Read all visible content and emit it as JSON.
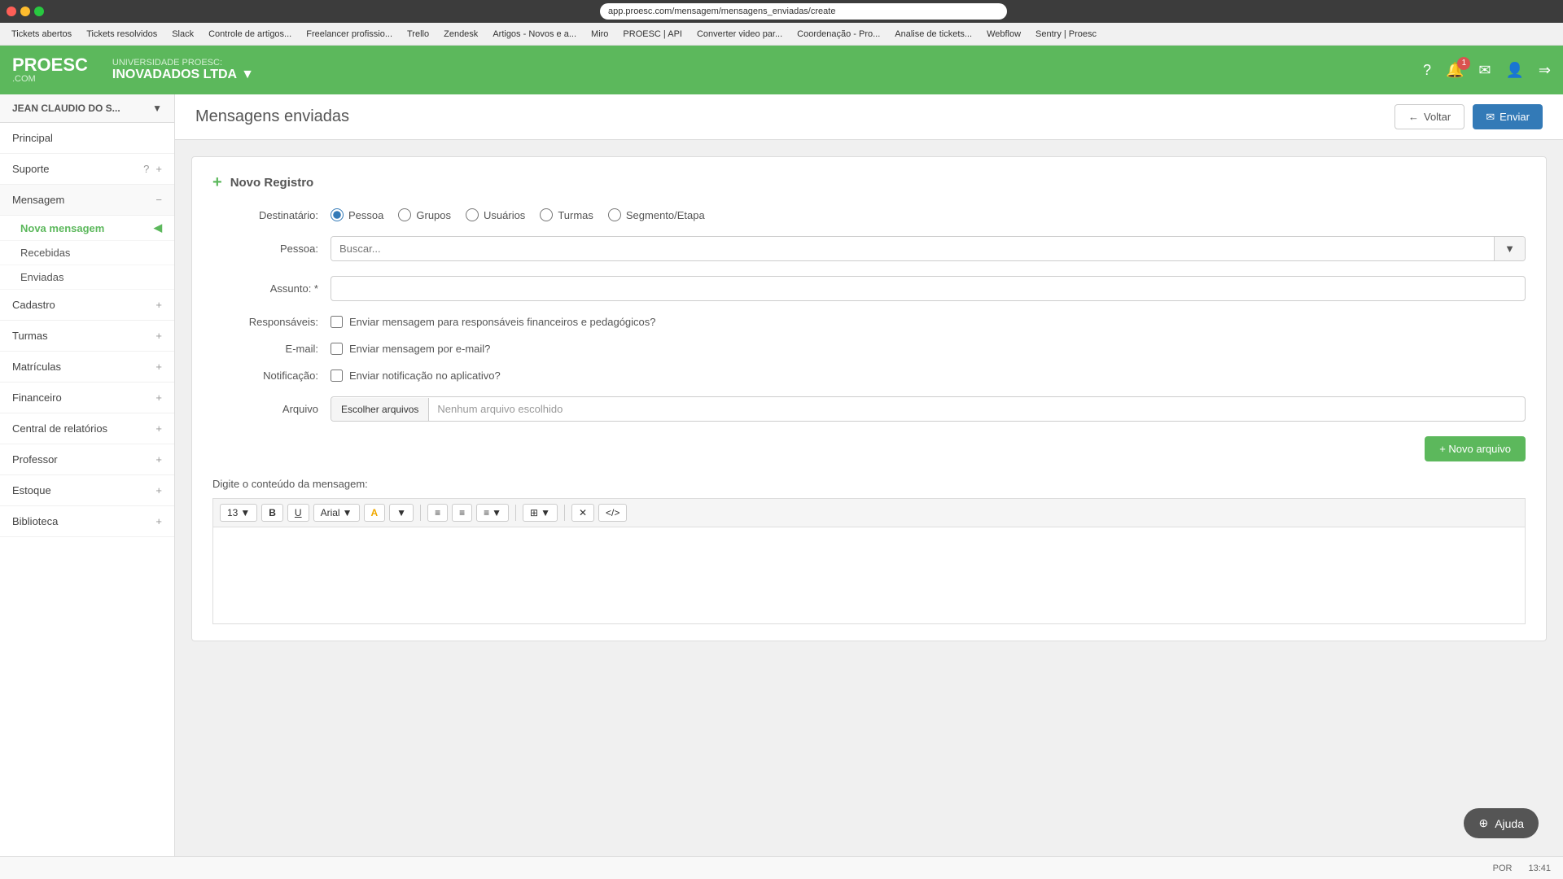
{
  "browser": {
    "url": "app.proesc.com/mensagem/mensagens_enviadas/create",
    "bookmarks": [
      {
        "label": "Tickets abertos"
      },
      {
        "label": "Tickets resolvidos"
      },
      {
        "label": "Slack"
      },
      {
        "label": "Controle de artigos..."
      },
      {
        "label": "Freelancer profissio..."
      },
      {
        "label": "Trello"
      },
      {
        "label": "Zendesk"
      },
      {
        "label": "Artigos - Novos e a..."
      },
      {
        "label": "Miro"
      },
      {
        "label": "PROESC | API"
      },
      {
        "label": "Converter video par..."
      },
      {
        "label": "Coordenação - Pro..."
      },
      {
        "label": "Analise de tickets..."
      },
      {
        "label": "Webflow"
      },
      {
        "label": "Sentry | Proesc"
      }
    ]
  },
  "header": {
    "university_label": "UNIVERSIDADE PROESC:",
    "company_name": "INOVADADOS LTDA",
    "notification_count": "1"
  },
  "sidebar": {
    "user_name": "JEAN CLAUDIO DO S...",
    "items": [
      {
        "label": "Principal",
        "type": "main"
      },
      {
        "label": "Suporte",
        "type": "main",
        "hasHelp": true,
        "hasPlus": true
      },
      {
        "label": "Mensagem",
        "type": "section",
        "hasMinus": true
      },
      {
        "label": "Nova mensagem",
        "type": "sub",
        "active": true
      },
      {
        "label": "Recebidas",
        "type": "sub"
      },
      {
        "label": "Enviadas",
        "type": "sub"
      },
      {
        "label": "Cadastro",
        "type": "main",
        "hasPlus": true
      },
      {
        "label": "Turmas",
        "type": "main",
        "hasPlus": true
      },
      {
        "label": "Matrículas",
        "type": "main",
        "hasPlus": true
      },
      {
        "label": "Financeiro",
        "type": "main",
        "hasPlus": true
      },
      {
        "label": "Central de relatórios",
        "type": "main",
        "hasPlus": true
      },
      {
        "label": "Professor",
        "type": "main",
        "hasPlus": true
      },
      {
        "label": "Estoque",
        "type": "main",
        "hasPlus": true
      },
      {
        "label": "Biblioteca",
        "type": "main",
        "hasPlus": true
      }
    ]
  },
  "page": {
    "title": "Mensagens enviadas",
    "back_button": "Voltar",
    "send_button": "Enviar"
  },
  "form": {
    "section_title": "Novo Registro",
    "destinatario_label": "Destinatário:",
    "destinatario_options": [
      {
        "id": "pessoa",
        "label": "Pessoa",
        "checked": true
      },
      {
        "id": "grupos",
        "label": "Grupos",
        "checked": false
      },
      {
        "id": "usuarios",
        "label": "Usuários",
        "checked": false
      },
      {
        "id": "turmas",
        "label": "Turmas",
        "checked": false
      },
      {
        "id": "segmento",
        "label": "Segmento/Etapa",
        "checked": false
      }
    ],
    "pessoa_label": "Pessoa:",
    "pessoa_placeholder": "Buscar...",
    "assunto_label": "Assunto: *",
    "responsaveis_label": "Responsáveis:",
    "responsaveis_checkbox": "Enviar mensagem para responsáveis financeiros e pedagógicos?",
    "email_label": "E-mail:",
    "email_checkbox": "Enviar mensagem por e-mail?",
    "notificacao_label": "Notificação:",
    "notificacao_checkbox": "Enviar notificação no aplicativo?",
    "arquivo_label": "Arquivo",
    "file_btn_label": "Escolher arquivos",
    "file_placeholder": "Nenhum arquivo escolhido",
    "new_file_btn": "+ Novo arquivo",
    "message_content_label": "Digite o conteúdo da mensagem:",
    "toolbar": {
      "font_size": "13",
      "bold": "B",
      "underline": "U",
      "font_family": "Arial",
      "color_A": "A",
      "list_unordered": "≡",
      "list_ordered": "≡",
      "align": "≡",
      "table": "⊞",
      "clear": "✕",
      "code": "</>"
    }
  },
  "help": {
    "label": "Ajuda"
  },
  "status_bar": {
    "language": "POR",
    "time": "13:41"
  }
}
